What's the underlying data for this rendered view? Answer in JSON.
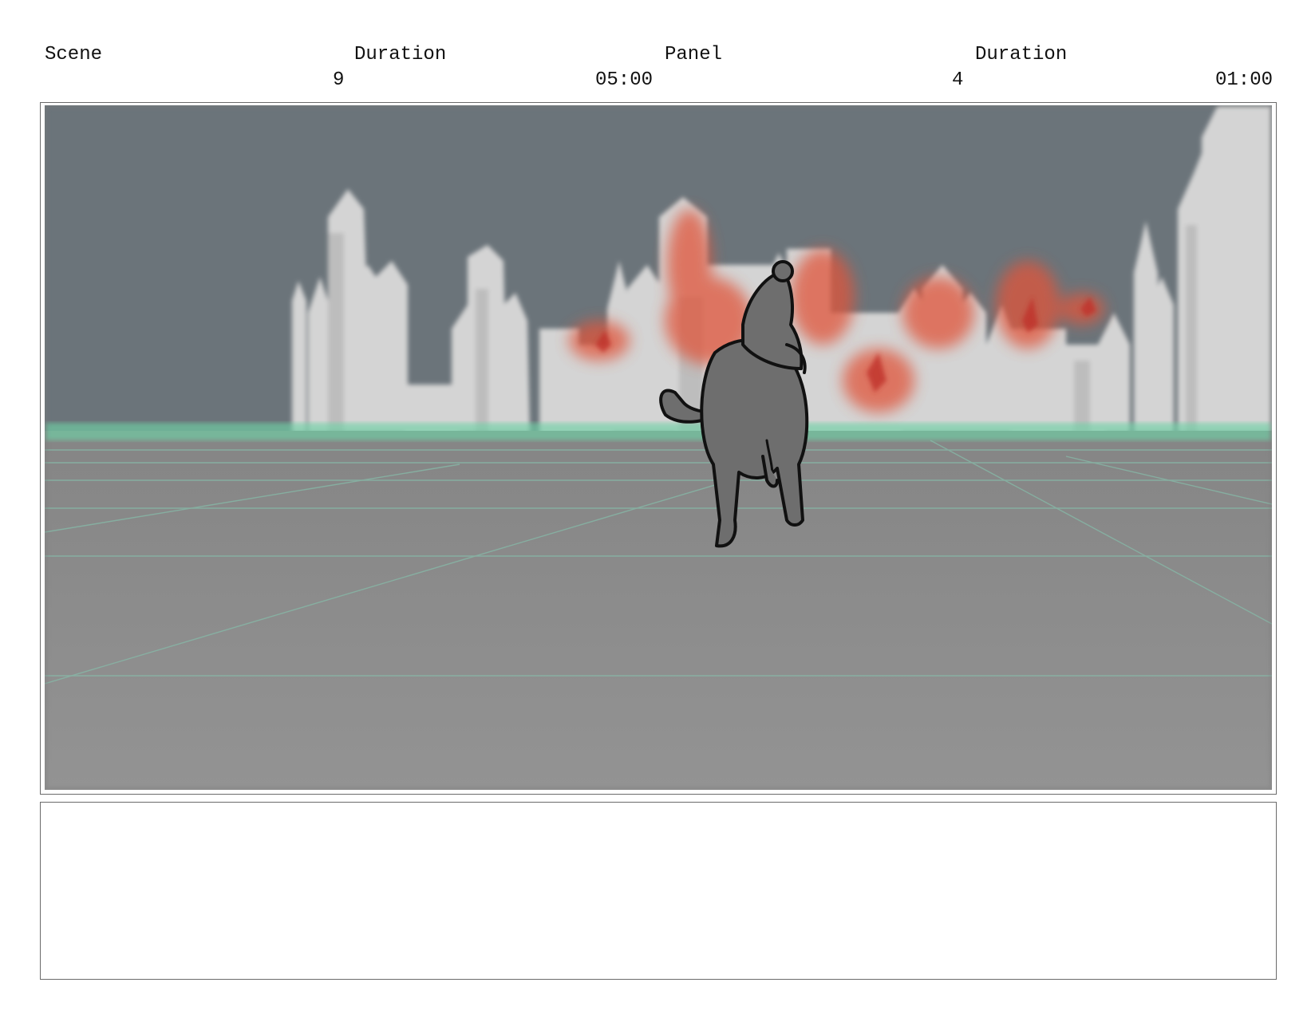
{
  "header": {
    "scene_label": "Scene",
    "scene_value": "9",
    "scene_duration_label": "Duration",
    "scene_duration_value": "05:00",
    "panel_label": "Panel",
    "panel_value": "4",
    "panel_duration_label": "Duration",
    "panel_duration_value": "01:00"
  },
  "panel": {
    "sky_color": "#6b747a",
    "ground_color": "#8e8e8e",
    "horizon_glow_color": "#6fd1a6",
    "fire_color": "#e0553a",
    "building_color": "#d4d4d4",
    "rider_color": "#6e6e6e"
  },
  "notes": {
    "text": ""
  }
}
